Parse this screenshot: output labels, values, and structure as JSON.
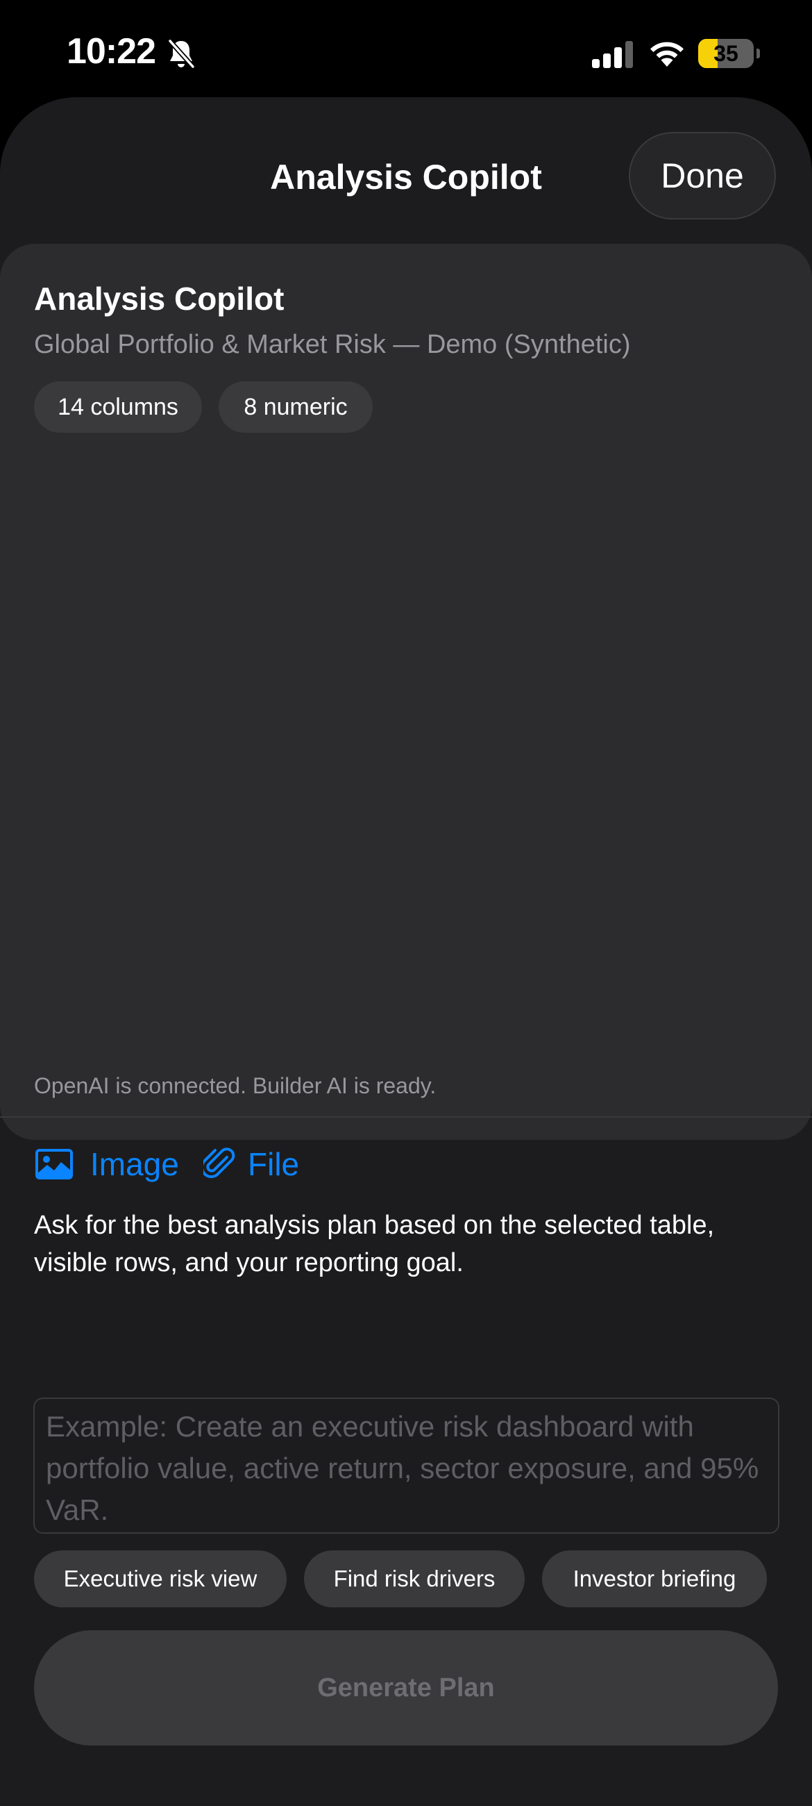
{
  "status_bar": {
    "time": "10:22",
    "battery_level": "35",
    "icons": [
      "bell-slash-icon",
      "cellular-signal-icon",
      "wifi-icon",
      "battery-icon"
    ]
  },
  "nav": {
    "title": "Analysis Copilot",
    "done_label": "Done"
  },
  "card": {
    "title": "Analysis Copilot",
    "subtitle": "Global Portfolio & Market Risk — Demo (Synthetic)",
    "chips": [
      "14 columns",
      "8 numeric"
    ]
  },
  "connection_status": "OpenAI is connected. Builder AI is ready.",
  "attachments": {
    "image_label": "Image",
    "file_label": "File",
    "image_icon": "photo-icon",
    "file_icon": "paperclip-icon"
  },
  "prompt": {
    "help_text": "Ask for the best analysis plan based on the selected table, visible rows, and your reporting goal.",
    "value": "",
    "placeholder": "Example: Create an executive risk dashboard with portfolio value, active return, sector exposure, and 95% VaR."
  },
  "suggestions": [
    "Executive risk view",
    "Find risk drivers",
    "Investor briefing"
  ],
  "generate_label": "Generate Plan",
  "colors": {
    "background": "#000000",
    "sheet": "#1c1c1e",
    "card": "#2c2c2e",
    "chip": "#3a3a3c",
    "accent": "#0a84ff",
    "secondary_text": "#98989d",
    "battery_fill": "#f7d108"
  }
}
